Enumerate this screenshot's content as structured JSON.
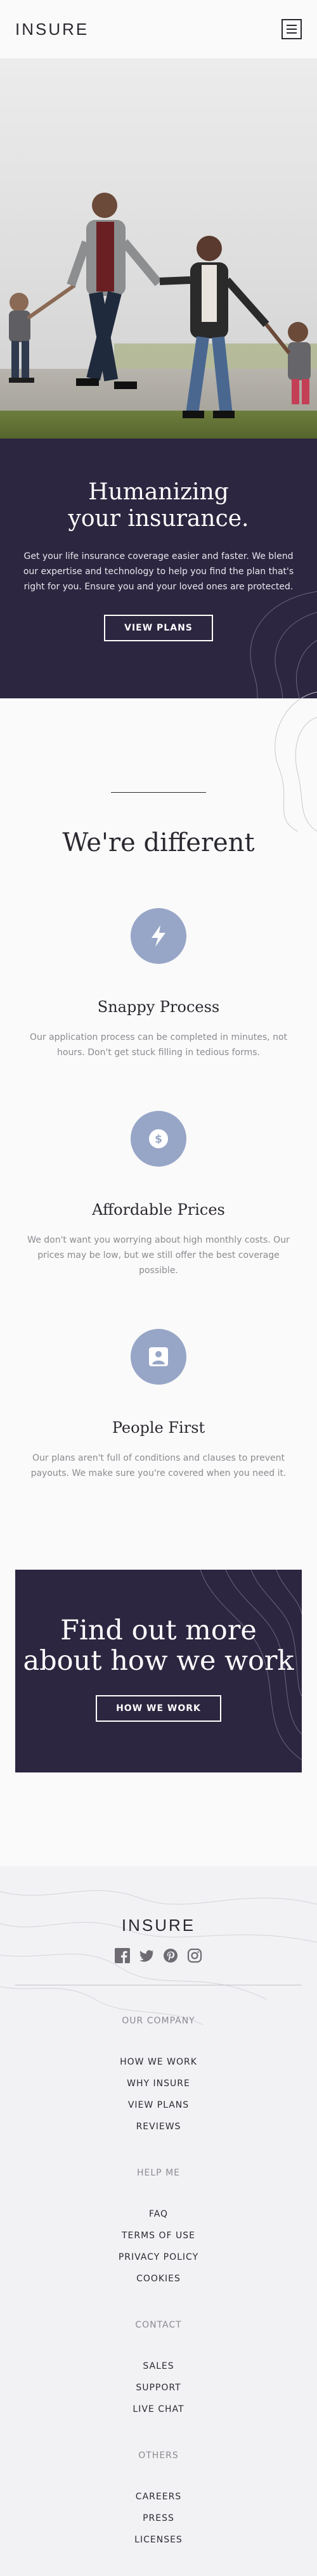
{
  "header": {
    "logo": "INSURE",
    "menu_icon": "hamburger-menu-icon"
  },
  "hero": {
    "title_line1": "Humanizing",
    "title_line2": "your insurance.",
    "description": "Get your life insurance coverage easier and faster. We blend our expertise and technology to help you find the plan that's right for you. Ensure you and your loved ones are protected.",
    "button": "VIEW PLANS"
  },
  "different": {
    "title": "We're different",
    "features": [
      {
        "icon": "lightning-icon",
        "title": "Snappy Process",
        "text": "Our application process can be completed in minutes, not hours. Don't get stuck filling in tedious forms."
      },
      {
        "icon": "dollar-icon",
        "title": "Affordable Prices",
        "text": "We don't want you worrying about high monthly costs. Our prices may be low, but we still offer the best coverage possible."
      },
      {
        "icon": "person-icon",
        "title": "People First",
        "text": "Our plans aren't full of conditions and clauses to prevent payouts. We make sure you're covered when you need it."
      }
    ]
  },
  "how_we_work": {
    "title_line1": "Find out more",
    "title_line2": "about how we work",
    "button": "HOW WE WORK"
  },
  "footer": {
    "logo": "INSURE",
    "socials": [
      "facebook-icon",
      "twitter-icon",
      "pinterest-icon",
      "instagram-icon"
    ],
    "groups": [
      {
        "title": "OUR COMPANY",
        "links": [
          "HOW WE WORK",
          "WHY INSURE",
          "VIEW PLANS",
          "REVIEWS"
        ]
      },
      {
        "title": "HELP ME",
        "links": [
          "FAQ",
          "TERMS OF USE",
          "PRIVACY POLICY",
          "COOKIES"
        ]
      },
      {
        "title": "CONTACT",
        "links": [
          "SALES",
          "SUPPORT",
          "LIVE CHAT"
        ]
      },
      {
        "title": "OTHERS",
        "links": [
          "CAREERS",
          "PRESS",
          "LICENSES"
        ]
      }
    ]
  },
  "colors": {
    "dark_violet": "#2c2640",
    "very_dark_violet": "#2c2830",
    "icon_circle": "#97a6c7",
    "light_grey": "#fafafa",
    "grey_text": "#8c8a90"
  }
}
